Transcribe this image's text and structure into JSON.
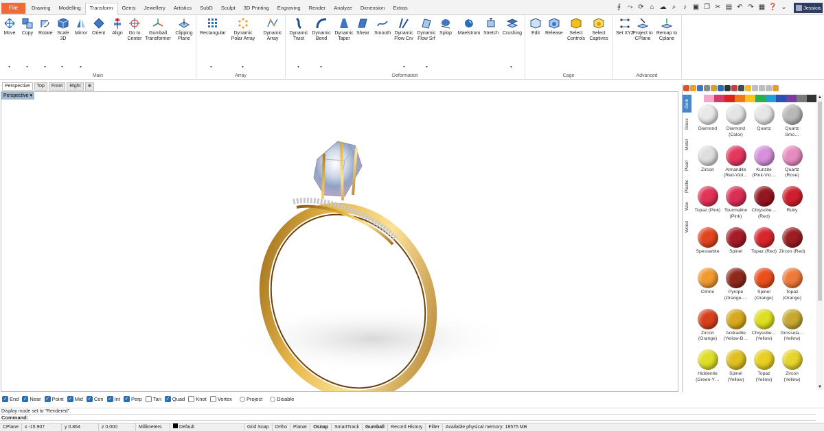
{
  "file_tab": "File",
  "ribbon_tabs": [
    "Drawing",
    "Modelling",
    "Transform",
    "Gems",
    "Jewellery",
    "Artistics",
    "SubD",
    "Sculpt",
    "3D Printing",
    "Engraving",
    "Render",
    "Analyze",
    "Dimension",
    "Extras"
  ],
  "active_tab": "Transform",
  "user": "Jessica",
  "groups": {
    "main": "Main",
    "array": "Array",
    "deformation": "Deformation",
    "cage": "Cage",
    "advanced": "Advanced"
  },
  "tools": {
    "move": "Move",
    "copy": "Copy",
    "rotate": "Rotate",
    "scale": "Scale 3D",
    "mirror": "Mirror",
    "orient": "Orient",
    "align": "Align",
    "goto": "Go to Center",
    "gumball": "Gumball Transformer",
    "clipping": "Clipping Plane",
    "rect": "Rectangular",
    "dpolar": "Dynamic Polar Array",
    "darray": "Dynamic Array",
    "dtwist": "Dynamic Twist",
    "dbend": "Dynamic Bend",
    "dtaper": "Dynamic Taper",
    "shear": "Shear",
    "smooth": "Smooth",
    "dflowcrv": "Dynamic Flow Crv",
    "dflowsrf": "Dynamic Flow Srf",
    "splop": "Splop",
    "maelstrom": "Maelstrom",
    "stretch": "Stretch",
    "crushing": "Crushing",
    "edit": "Edit",
    "release": "Release",
    "selcontrols": "Select Controls",
    "selcaptives": "Select Captives",
    "setxyz": "Set XYZ",
    "projcplane": "Project to CPlane",
    "remap": "Remap to Cplane"
  },
  "viewport_tabs": [
    "Perspective",
    "Top",
    "Front",
    "Right"
  ],
  "viewport_label": "Perspective",
  "osnaps": [
    {
      "label": "End",
      "on": true
    },
    {
      "label": "Near",
      "on": true
    },
    {
      "label": "Point",
      "on": true
    },
    {
      "label": "Mid",
      "on": true
    },
    {
      "label": "Cen",
      "on": true
    },
    {
      "label": "Int",
      "on": true
    },
    {
      "label": "Perp",
      "on": true
    },
    {
      "label": "Tan",
      "on": false
    },
    {
      "label": "Quad",
      "on": true
    },
    {
      "label": "Knot",
      "on": false
    },
    {
      "label": "Vertex",
      "on": false
    }
  ],
  "osnap_radios": [
    "Project",
    "Disable"
  ],
  "history_line": "Display mode set to \"Rendered\".",
  "command_label": "Command:",
  "status": {
    "cplane": "CPlane",
    "x": "x -15.907",
    "y": "y 0.864",
    "z": "z 0.000",
    "units": "Millimeters",
    "layer": "Default",
    "grid_snap": "Grid Snap",
    "ortho": "Ortho",
    "planar": "Planar",
    "osnap": "Osnap",
    "smarttrack": "SmartTrack",
    "gumball": "Gumball",
    "record": "Record History",
    "filter": "Filter",
    "memory": "Available physical memory: 18575 MB"
  },
  "material_tabs": [
    "Gem",
    "Glass",
    "Metal",
    "Pearl",
    "Plastic",
    "Wax",
    "Wood"
  ],
  "swatch_colors": [
    "#ffffff",
    "#f4a6c8",
    "#d63a6a",
    "#e02020",
    "#f07a1a",
    "#f7c51a",
    "#2ab04a",
    "#1f9ed8",
    "#2a4fb5",
    "#7a3aa0",
    "#7a7a7a",
    "#333333"
  ],
  "gems": [
    {
      "name": "Diamond",
      "color": "#e8e8e8"
    },
    {
      "name": "Diamond (Color)",
      "color": "#e4e4e4"
    },
    {
      "name": "Quartz",
      "color": "#e6e6e6"
    },
    {
      "name": "Quartz Smo…",
      "color": "#b8b8b8"
    },
    {
      "name": "Zircon",
      "color": "#dedede"
    },
    {
      "name": "Almandite (Red-Viol…",
      "color": "#e3375e"
    },
    {
      "name": "Kunzite (Pink-Vio…",
      "color": "#d690dc"
    },
    {
      "name": "Quartz (Rose)",
      "color": "#e78cc0"
    },
    {
      "name": "Topaz (Pink)",
      "color": "#e03355"
    },
    {
      "name": "Tourmaline (Pink)",
      "color": "#db2e55"
    },
    {
      "name": "Chrysobe… (Red)",
      "color": "#941620"
    },
    {
      "name": "Ruby",
      "color": "#cf1f2e"
    },
    {
      "name": "Spessartite",
      "color": "#e04520"
    },
    {
      "name": "Spinel",
      "color": "#a51c28"
    },
    {
      "name": "Topaz (Red)",
      "color": "#d8262e"
    },
    {
      "name": "Zircon (Red)",
      "color": "#9a1e22"
    },
    {
      "name": "Citrine",
      "color": "#f09a30"
    },
    {
      "name": "Pyrope (Orange-…",
      "color": "#8e2a1c"
    },
    {
      "name": "Spinel (Orange)",
      "color": "#ec4e1c"
    },
    {
      "name": "Topaz (Orange)",
      "color": "#ee7a3a"
    },
    {
      "name": "Zircon (Orange)",
      "color": "#d8401c"
    },
    {
      "name": "Andradite (Yellow-B…",
      "color": "#d8a820"
    },
    {
      "name": "Chrysobe… (Yellow)",
      "color": "#dede20"
    },
    {
      "name": "Grossula… (Yellow)",
      "color": "#c8a830"
    },
    {
      "name": "Hiddenite (Green-Y…",
      "color": "#dede28"
    },
    {
      "name": "Spinel (Yellow)",
      "color": "#e0c020"
    },
    {
      "name": "Topaz (Yellow)",
      "color": "#e8d020"
    },
    {
      "name": "Zircon (Yellow)",
      "color": "#e6d52c"
    }
  ]
}
